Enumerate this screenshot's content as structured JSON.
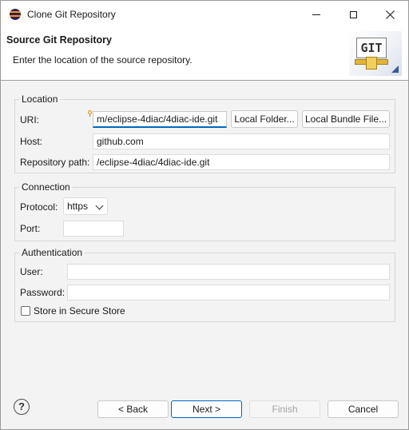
{
  "window": {
    "title": "Clone Git Repository"
  },
  "header": {
    "title": "Source Git Repository",
    "description": "Enter the location of the source repository.",
    "banner_text": "GIT"
  },
  "location": {
    "group_label": "Location",
    "uri_label": "URI:",
    "uri_value": "m/eclipse-4diac/4diac-ide.git",
    "local_folder_button": "Local Folder...",
    "local_bundle_button": "Local Bundle File...",
    "host_label": "Host:",
    "host_value": "github.com",
    "repo_path_label": "Repository path:",
    "repo_path_value": "/eclipse-4diac/4diac-ide.git"
  },
  "connection": {
    "group_label": "Connection",
    "protocol_label": "Protocol:",
    "protocol_value": "https",
    "port_label": "Port:",
    "port_value": ""
  },
  "authentication": {
    "group_label": "Authentication",
    "user_label": "User:",
    "user_value": "",
    "password_label": "Password:",
    "password_value": "",
    "secure_store_label": "Store in Secure Store",
    "secure_store_checked": false
  },
  "footer": {
    "help_glyph": "?",
    "back_button": "< Back",
    "next_button": "Next >",
    "finish_button": "Finish",
    "cancel_button": "Cancel"
  },
  "icons": {
    "app": "eclipse-icon",
    "minimize": "minimize-icon",
    "maximize": "maximize-icon",
    "close": "close-icon",
    "help": "help-icon",
    "hint": "content-assist-bulb-icon"
  },
  "colors": {
    "focus_accent": "#0067c0",
    "dialog_background": "#f3f3f3"
  }
}
